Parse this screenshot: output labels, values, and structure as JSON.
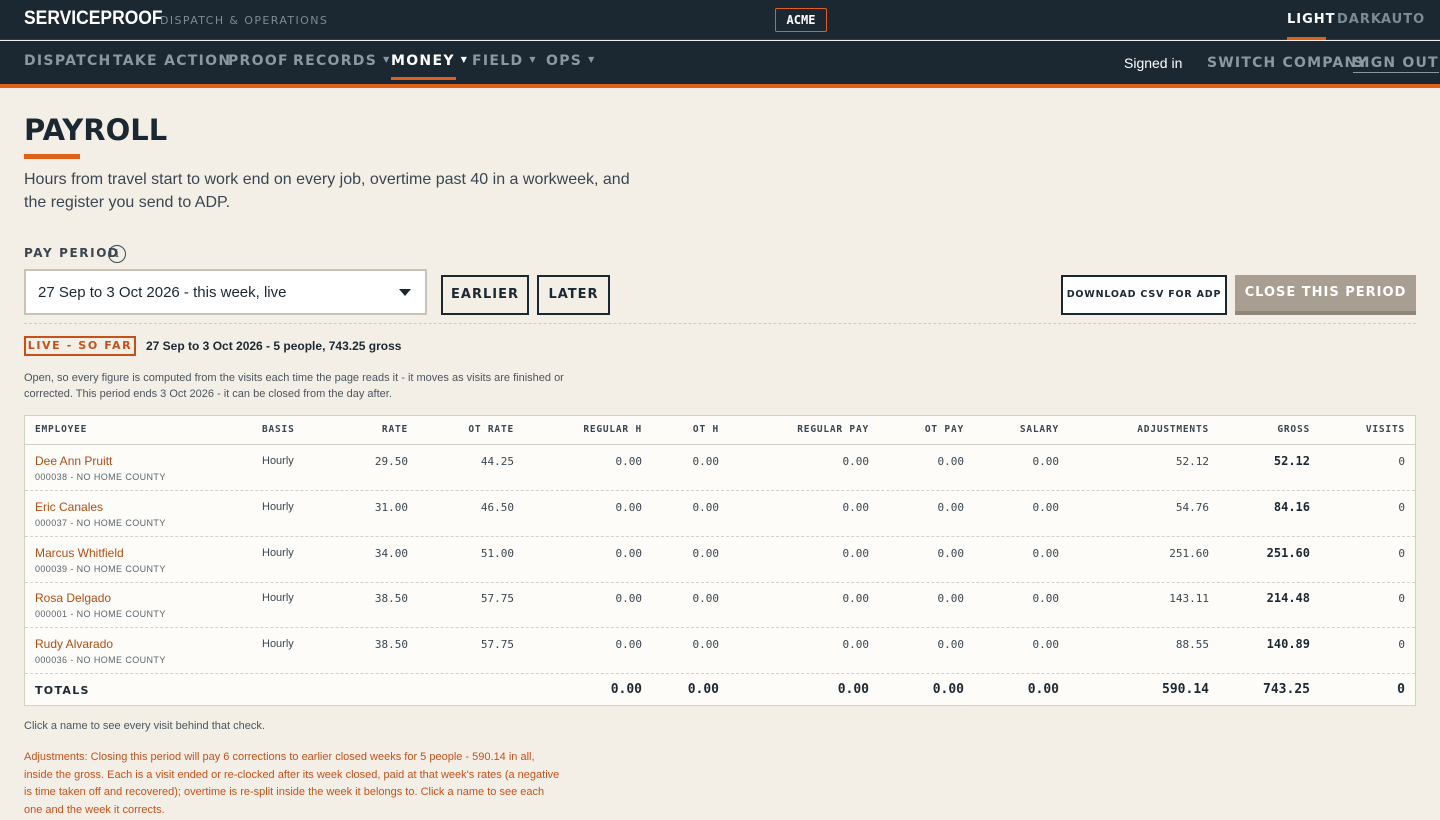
{
  "header": {
    "brand": "SERVICEPROOF",
    "brand_sub": "DISPATCH & OPERATIONS",
    "company_badge": "ACME",
    "themes": [
      {
        "label": "LIGHT",
        "active": true
      },
      {
        "label": "DARK",
        "active": false
      },
      {
        "label": "AUTO",
        "active": false
      }
    ]
  },
  "nav": {
    "items": [
      {
        "label": "DISPATCH",
        "dropdown": false,
        "active": false
      },
      {
        "label": "TAKE ACTION",
        "dropdown": false,
        "active": false
      },
      {
        "label": "PROOF",
        "dropdown": false,
        "active": false
      },
      {
        "label": "RECORDS",
        "dropdown": true,
        "active": false
      },
      {
        "label": "MONEY",
        "dropdown": true,
        "active": true
      },
      {
        "label": "FIELD",
        "dropdown": true,
        "active": false
      },
      {
        "label": "OPS",
        "dropdown": true,
        "active": false
      }
    ],
    "signed_in": "Signed in",
    "switch_company": "SWITCH COMPANY",
    "sign_out": "SIGN OUT"
  },
  "page": {
    "title": "PAYROLL",
    "lede": "Hours from travel start to work end on every job, overtime past 40 in a workweek, and the register you send to ADP.",
    "pay_period_label": "PAY PERIOD",
    "pay_period_value": "27 Sep to 3 Oct 2026 - this week, live",
    "earlier": "EARLIER",
    "later": "LATER",
    "download_csv": "DOWNLOAD CSV FOR ADP",
    "close_period": "CLOSE THIS PERIOD",
    "badge": "LIVE - SO FAR",
    "badge_summary": "27 Sep to 3 Oct 2026 - 5 people, 743.25 gross",
    "note": "Open, so every figure is computed from the visits each time the page reads it - it moves as visits are finished or corrected. This period ends 3 Oct 2026 - it can be closed from the day after.",
    "click_note": "Click a name to see every visit behind that check.",
    "adjustments_note": "Adjustments: Closing this period will pay 6 corrections to earlier closed weeks for 5 people - 590.14 in all, inside the gross. Each is a visit ended or re-clocked after its week closed, paid at that week's rates (a negative is time taken off and recovered); overtime is re-split inside the week it belongs to. Click a name to see each one and the week it corrects."
  },
  "table": {
    "headers": {
      "employee": "EMPLOYEE",
      "basis": "BASIS",
      "rate": "RATE",
      "ot_rate": "OT RATE",
      "regular_h": "REGULAR H",
      "ot_h": "OT H",
      "regular_pay": "REGULAR PAY",
      "ot_pay": "OT PAY",
      "salary": "SALARY",
      "adjustments": "ADJUSTMENTS",
      "gross": "GROSS",
      "visits": "VISITS"
    },
    "rows": [
      {
        "name": "Dee Ann Pruitt",
        "sub": "000038 - NO HOME COUNTY",
        "basis": "Hourly",
        "rate": "29.50",
        "ot_rate": "44.25",
        "regular_h": "0.00",
        "ot_h": "0.00",
        "regular_pay": "0.00",
        "ot_pay": "0.00",
        "salary": "0.00",
        "adjustments": "52.12",
        "gross": "52.12",
        "visits": "0"
      },
      {
        "name": "Eric Canales",
        "sub": "000037 - NO HOME COUNTY",
        "basis": "Hourly",
        "rate": "31.00",
        "ot_rate": "46.50",
        "regular_h": "0.00",
        "ot_h": "0.00",
        "regular_pay": "0.00",
        "ot_pay": "0.00",
        "salary": "0.00",
        "adjustments": "54.76",
        "gross": "84.16",
        "visits": "0"
      },
      {
        "name": "Marcus Whitfield",
        "sub": "000039 - NO HOME COUNTY",
        "basis": "Hourly",
        "rate": "34.00",
        "ot_rate": "51.00",
        "regular_h": "0.00",
        "ot_h": "0.00",
        "regular_pay": "0.00",
        "ot_pay": "0.00",
        "salary": "0.00",
        "adjustments": "251.60",
        "gross": "251.60",
        "visits": "0"
      },
      {
        "name": "Rosa Delgado",
        "sub": "000001 - NO HOME COUNTY",
        "basis": "Hourly",
        "rate": "38.50",
        "ot_rate": "57.75",
        "regular_h": "0.00",
        "ot_h": "0.00",
        "regular_pay": "0.00",
        "ot_pay": "0.00",
        "salary": "0.00",
        "adjustments": "143.11",
        "gross": "214.48",
        "visits": "0"
      },
      {
        "name": "Rudy Alvarado",
        "sub": "000036 - NO HOME COUNTY",
        "basis": "Hourly",
        "rate": "38.50",
        "ot_rate": "57.75",
        "regular_h": "0.00",
        "ot_h": "0.00",
        "regular_pay": "0.00",
        "ot_pay": "0.00",
        "salary": "0.00",
        "adjustments": "88.55",
        "gross": "140.89",
        "visits": "0"
      }
    ],
    "totals": {
      "label": "TOTALS",
      "regular_h": "0.00",
      "ot_h": "0.00",
      "regular_pay": "0.00",
      "ot_pay": "0.00",
      "salary": "0.00",
      "adjustments": "590.14",
      "gross": "743.25",
      "visits": "0"
    }
  },
  "colors": {
    "accent": "#e0601a",
    "navy": "#1b2832",
    "link": "#b24d12",
    "background": "#f3efe7"
  }
}
